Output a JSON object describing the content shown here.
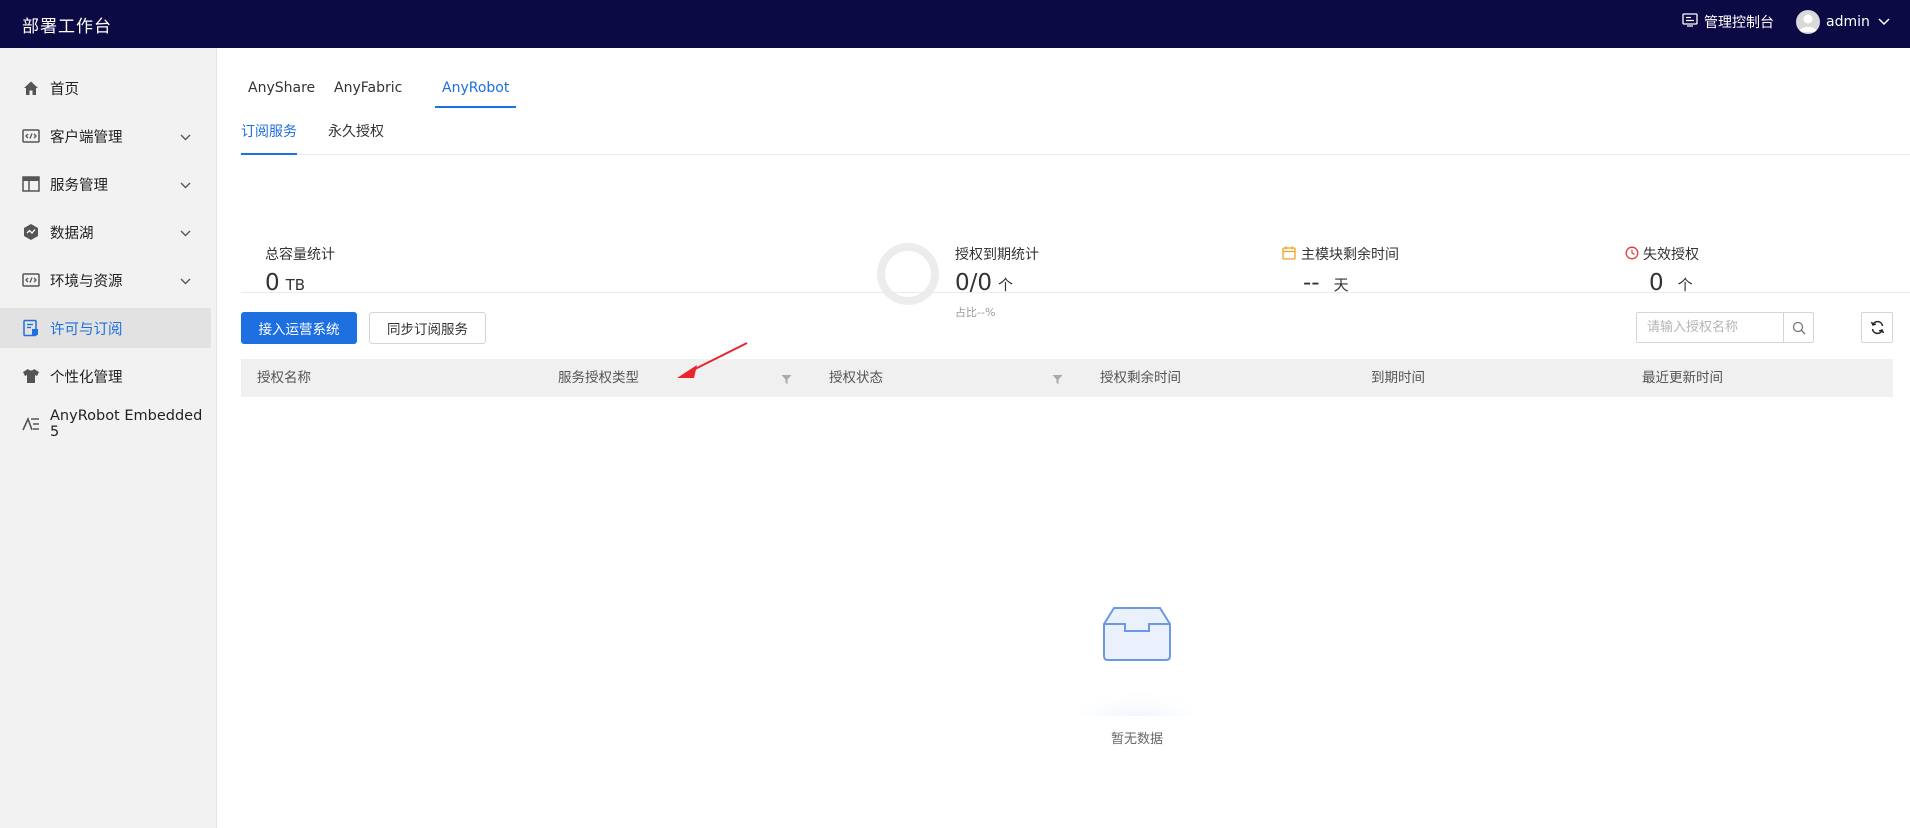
{
  "header": {
    "app_title": "部署工作台",
    "console_label": "管理控制台",
    "user_name": "admin"
  },
  "sidebar": {
    "items": [
      {
        "label": "首页",
        "icon": "home-icon",
        "has_submenu": false
      },
      {
        "label": "客户端管理",
        "icon": "code-window-icon",
        "has_submenu": true
      },
      {
        "label": "服务管理",
        "icon": "layout-icon",
        "has_submenu": true
      },
      {
        "label": "数据湖",
        "icon": "data-lake-icon",
        "has_submenu": true
      },
      {
        "label": "环境与资源",
        "icon": "environment-icon",
        "has_submenu": true
      },
      {
        "label": "许可与订阅",
        "icon": "license-icon",
        "has_submenu": false,
        "active": true
      },
      {
        "label": "个性化管理",
        "icon": "tshirt-icon",
        "has_submenu": false
      },
      {
        "label": "AnyRobot Embedded 5",
        "icon": "anyrobot-icon",
        "has_submenu": false
      }
    ]
  },
  "product_tabs": [
    "AnyShare",
    "AnyFabric",
    "AnyRobot"
  ],
  "active_product_tab": "AnyRobot",
  "sub_tabs": [
    "订阅服务",
    "永久授权"
  ],
  "active_sub_tab": "订阅服务",
  "stats": {
    "capacity": {
      "label": "总容量统计",
      "value": "0",
      "unit": "TB"
    },
    "expiry": {
      "label": "授权到期统计",
      "value": "0/0",
      "unit": "个",
      "sub": "占比--%"
    },
    "remaining": {
      "label": "主模块剩余时间",
      "value": "--",
      "unit": "天"
    },
    "invalid": {
      "label": "失效授权",
      "value": "0",
      "unit": "个"
    }
  },
  "toolbar": {
    "connect_label": "接入运营系统",
    "sync_label": "同步订阅服务",
    "search_placeholder": "请输入授权名称"
  },
  "table": {
    "columns": [
      "授权名称",
      "服务授权类型",
      "授权状态",
      "授权剩余时间",
      "到期时间",
      "最近更新时间"
    ]
  },
  "empty_text": "暂无数据",
  "colors": {
    "header_bg": "#0c0a45",
    "accent": "#1e6fe0",
    "remaining_icon": "#f0a020",
    "invalid_icon": "#e0383e",
    "annotation_arrow": "#e8242c"
  }
}
